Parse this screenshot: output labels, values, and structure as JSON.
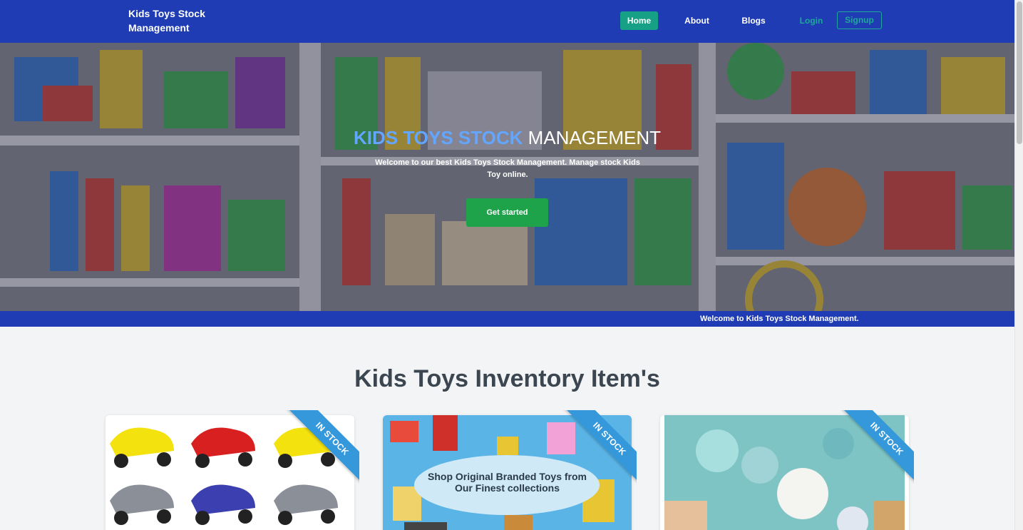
{
  "navbar": {
    "brand": "Kids Toys Stock Management",
    "links": {
      "home": "Home",
      "about": "About",
      "blogs": "Blogs",
      "login": "Login",
      "signup": "Signup"
    }
  },
  "hero": {
    "title_accent": "KIDS TOYS STOCK",
    "title_rest": "MANAGEMENT",
    "subtitle": "Welcome to our best Kids Toys Stock Management. Manage stock Kids Toy online.",
    "cta": "Get started"
  },
  "ticker": {
    "text": "Welcome to Kids Toys Stock Management."
  },
  "inventory": {
    "title": "Kids Toys Inventory Item's",
    "cards": [
      {
        "badge": "IN STOCK",
        "image_caption": ""
      },
      {
        "badge": "IN STOCK",
        "image_caption_line1": "Shop Original Branded Toys from",
        "image_caption_line2": "Our Finest collections"
      },
      {
        "badge": "IN STOCK",
        "image_caption": ""
      }
    ]
  },
  "colors": {
    "nav": "#1f3cb4",
    "home_active": "#16a085",
    "accent_teal": "#1fa89a",
    "cta_green": "#1ea34a",
    "ribbon": "#3498db",
    "title_accent": "#62a6ff"
  }
}
